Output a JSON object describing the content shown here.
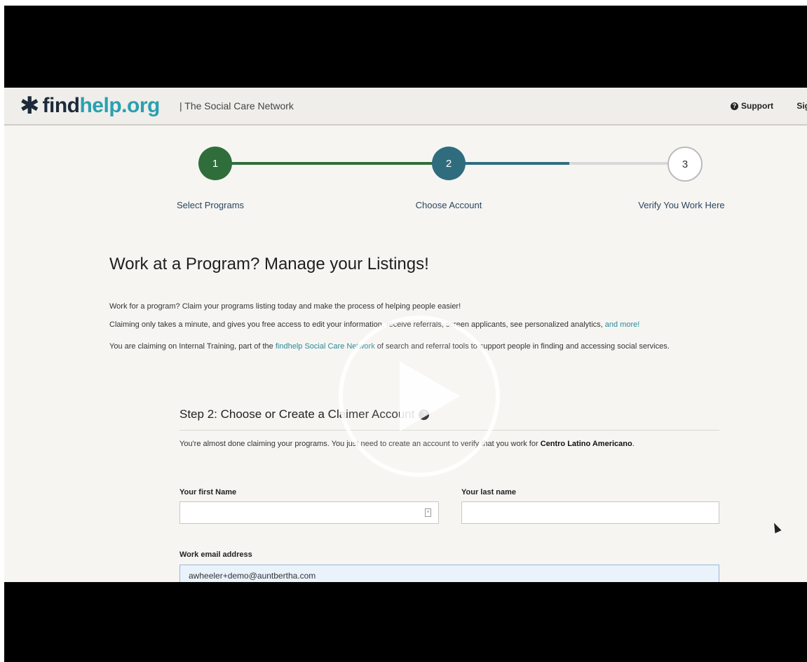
{
  "navbar": {
    "logo_plain": "find",
    "logo_accent": "help.org",
    "tagline": "| The Social Care Network",
    "support": "Support",
    "signin": "Sig"
  },
  "stepper": {
    "steps": [
      {
        "number": "1",
        "label": "Select Programs"
      },
      {
        "number": "2",
        "label": "Choose Account"
      },
      {
        "number": "3",
        "label": "Verify You Work Here"
      }
    ]
  },
  "main": {
    "title": "Work at a Program? Manage your Listings!",
    "para1": "Work for a program? Claim your programs listing today and make the process of helping people easier!",
    "para2_text": "Claiming only takes a minute, and gives you free access to edit your information, receive referrals, screen applicants, see personalized analytics, ",
    "para2_link": "and more!",
    "para3_a": "You are claiming on Internal Training, part of the ",
    "para3_link": "findhelp Social Care Network",
    "para3_b": " of search and referral tools to support people in finding and accessing social services."
  },
  "form": {
    "heading": "Step 2: Choose or Create a Claimer Account",
    "intro_a": "You're almost done claiming your programs. You just need to create an account to verify that you work for ",
    "intro_org": "Centro Latino Americano",
    "intro_end": ".",
    "first_name_label": "Your first Name",
    "first_name_value": "",
    "last_name_label": "Your last name",
    "last_name_value": "",
    "email_label": "Work email address",
    "email_value": "awheeler+demo@auntbertha.com"
  },
  "colors": {
    "step1": "#2f6e3a",
    "step2": "#2f6d7e",
    "accent": "#2aa0b0"
  },
  "icons": [
    "logo-star-icon",
    "question-circle-icon",
    "contact-card-icon",
    "play-icon",
    "mouse-cursor-icon"
  ]
}
